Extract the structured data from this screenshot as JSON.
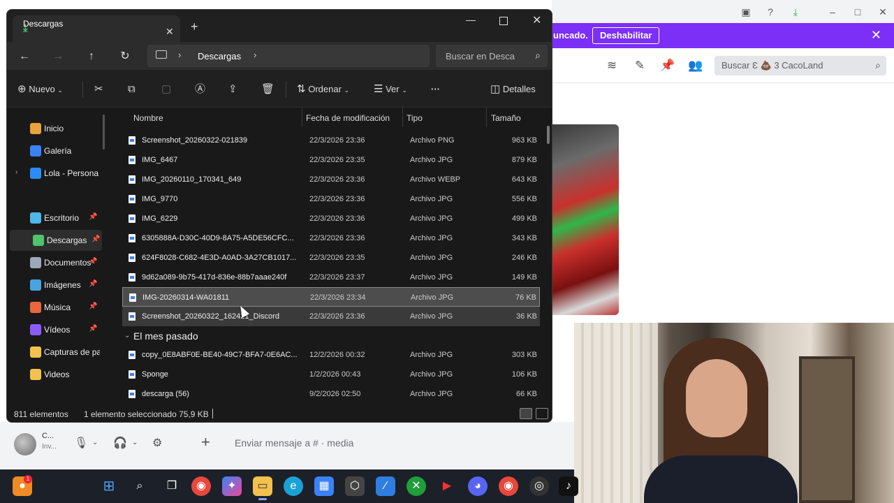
{
  "explorer": {
    "tab_title": "Descargas",
    "breadcrumb": "Descargas",
    "search_placeholder": "Buscar en Desca",
    "commands": {
      "new": "Nuevo",
      "sort": "Ordenar",
      "view": "Ver",
      "more": "···",
      "details": "Detalles"
    },
    "sidebar": [
      {
        "label": "Inicio",
        "icon": "home-icon",
        "color": "#e8a33b"
      },
      {
        "label": "Galería",
        "icon": "gallery-icon",
        "color": "#3b82f6"
      },
      {
        "label": "Lola - Persona",
        "icon": "onedrive-icon",
        "color": "#2a8df5"
      },
      {
        "label": "Escritorio",
        "icon": "desktop-icon",
        "color": "#4fb6e8"
      },
      {
        "label": "Descargas",
        "icon": "download-icon",
        "color": "#4fc36d"
      },
      {
        "label": "Documentos",
        "icon": "documents-icon",
        "color": "#9aa8b8"
      },
      {
        "label": "Imágenes",
        "icon": "pictures-icon",
        "color": "#4aa3e0"
      },
      {
        "label": "Música",
        "icon": "music-icon",
        "color": "#e8673b"
      },
      {
        "label": "Vídeos",
        "icon": "videos-icon",
        "color": "#8b5cf6"
      },
      {
        "label": "Capturas de pa",
        "icon": "folder-icon",
        "color": "#f2c14e"
      },
      {
        "label": "Videos",
        "icon": "folder-icon",
        "color": "#f2c14e"
      }
    ],
    "columns": {
      "name": "Nombre",
      "date": "Fecha de modificación",
      "type": "Tipo",
      "size": "Tamaño"
    },
    "files": [
      {
        "name": "Screenshot_20260322-021839",
        "date": "22/3/2026 23:36",
        "type": "Archivo PNG",
        "size": "963 KB"
      },
      {
        "name": "IMG_6467",
        "date": "22/3/2026 23:35",
        "type": "Archivo JPG",
        "size": "879 KB"
      },
      {
        "name": "IMG_20260110_170341_649",
        "date": "22/3/2026 23:36",
        "type": "Archivo WEBP",
        "size": "643 KB"
      },
      {
        "name": "IMG_9770",
        "date": "22/3/2026 23:36",
        "type": "Archivo JPG",
        "size": "556 KB"
      },
      {
        "name": "IMG_6229",
        "date": "22/3/2026 23:36",
        "type": "Archivo JPG",
        "size": "499 KB"
      },
      {
        "name": "6305888A-D30C-40D9-8A75-A5DE56CFC...",
        "date": "22/3/2026 23:36",
        "type": "Archivo JPG",
        "size": "343 KB"
      },
      {
        "name": "624F8028-C682-4E3D-A0AD-3A27CB1017...",
        "date": "22/3/2026 23:35",
        "type": "Archivo JPG",
        "size": "246 KB"
      },
      {
        "name": "9d62a089-9b75-417d-836e-88b7aaae240f",
        "date": "22/3/2026 23:37",
        "type": "Archivo JPG",
        "size": "149 KB"
      },
      {
        "name": "IMG-20260314-WA01811",
        "date": "22/3/2026 23:34",
        "type": "Archivo JPG",
        "size": "76 KB"
      },
      {
        "name": "Screenshot_20260322_162421_Discord",
        "date": "22/3/2026 23:36",
        "type": "Archivo JPG",
        "size": "36 KB"
      }
    ],
    "group_label": "El mes pasado",
    "files_last_month": [
      {
        "name": "copy_0E8ABF0E-BE40-49C7-BFA7-0E6AC...",
        "date": "12/2/2026 00:32",
        "type": "Archivo JPG",
        "size": "303 KB"
      },
      {
        "name": "Sponge",
        "date": "1/2/2026 00:43",
        "type": "Archivo JPG",
        "size": "106 KB"
      },
      {
        "name": "descarga (56)",
        "date": "9/2/2026 02:50",
        "type": "Archivo JPG",
        "size": "66 KB"
      }
    ],
    "status": {
      "count": "811 elementos",
      "selection": "1 elemento seleccionado  75,9 KB"
    }
  },
  "discord": {
    "notice_text": "uncado.",
    "notice_button": "Deshabilitar",
    "search_placeholder": "Buscar  Ɛ 💩 3 CacoLand",
    "user_name": "C...",
    "user_status": "Inv...",
    "message_placeholder": "Enviar mensaje a # · media",
    "accent": "#7b2ff7"
  },
  "taskbar": {
    "badge": "1",
    "icons": [
      "app-orange-icon",
      "windows-start-icon",
      "search-icon",
      "task-view-icon",
      "chrome-icon",
      "copilot-icon",
      "file-explorer-icon",
      "edge-icon",
      "store-icon",
      "app-settings-icon",
      "azure-icon",
      "xbox-icon",
      "youtube-icon",
      "discord-icon",
      "chrome-icon",
      "obs-icon",
      "tiktok-icon"
    ]
  }
}
